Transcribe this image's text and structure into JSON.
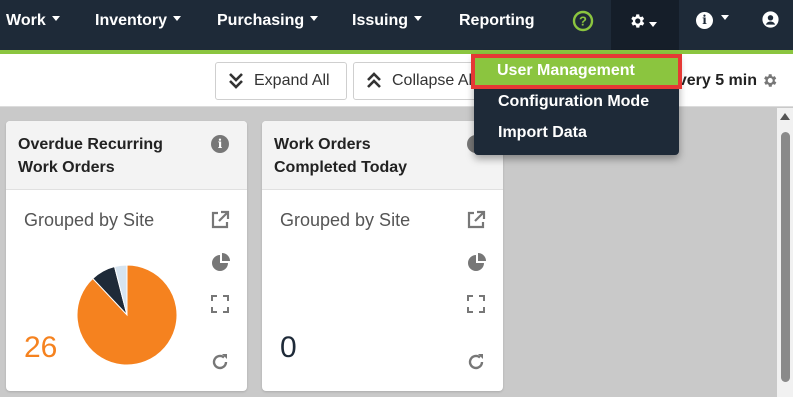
{
  "nav": {
    "items": [
      {
        "label": "Work",
        "dropdown": true
      },
      {
        "label": "Inventory",
        "dropdown": true
      },
      {
        "label": "Purchasing",
        "dropdown": true
      },
      {
        "label": "Issuing",
        "dropdown": true
      },
      {
        "label": "Reporting",
        "dropdown": false
      }
    ],
    "help_icon": "help-circle-icon",
    "settings_icon": "gear-icon",
    "info_icon": "info-icon",
    "user_icon": "user-icon"
  },
  "toolbar": {
    "expand_label": "Expand All",
    "collapse_label": "Collapse All",
    "refresh_text": "Refresh every 5 min"
  },
  "settings_menu": {
    "items": [
      {
        "label": "User Management",
        "highlighted": true
      },
      {
        "label": "Configuration Mode",
        "highlighted": false
      },
      {
        "label": "Import Data",
        "highlighted": false
      }
    ]
  },
  "cards": [
    {
      "title_line1": "Overdue Recurring",
      "title_line2": "Work Orders",
      "subtitle": "Grouped by Site",
      "count": "26",
      "count_color": "#f5821f",
      "pie": [
        {
          "value": 88,
          "color": "#f5821f"
        },
        {
          "value": 8,
          "color": "#1e2a38"
        },
        {
          "value": 4,
          "color": "#d6e4f0"
        }
      ]
    },
    {
      "title_line1": "Work Orders",
      "title_line2": "Completed Today",
      "subtitle": "Grouped by Site",
      "count": "0",
      "count_color": "#1e2a38",
      "pie": []
    }
  ],
  "colors": {
    "nav_bg": "#1e2a38",
    "accent": "#8bc53f",
    "highlight_border": "#e53935"
  }
}
